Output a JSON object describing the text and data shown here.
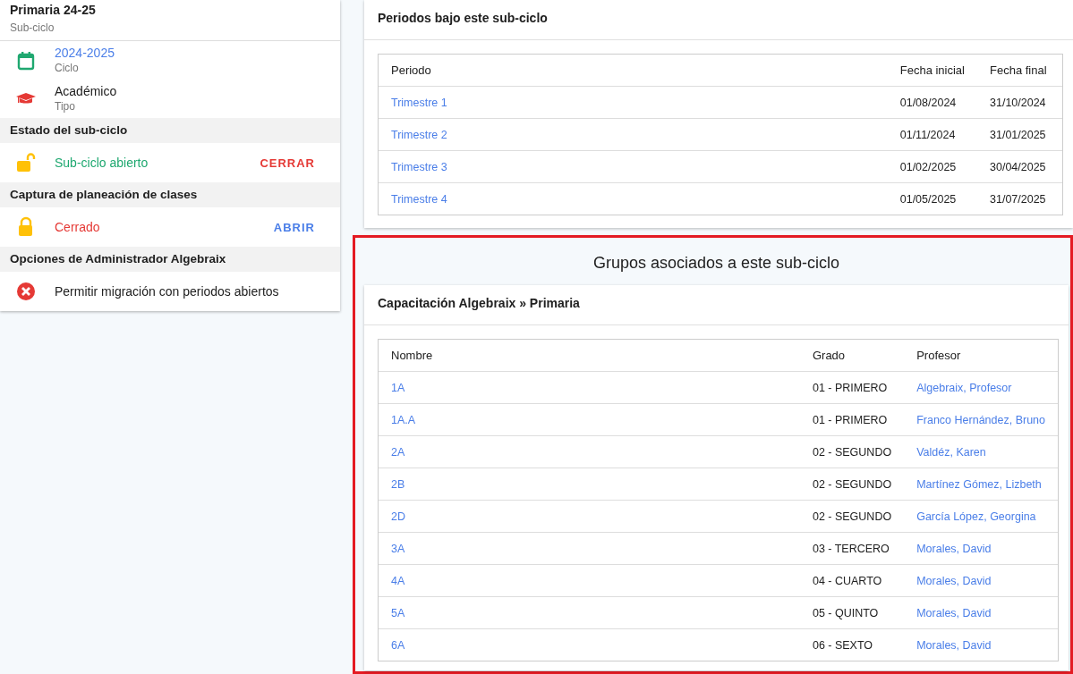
{
  "subcycle": {
    "title": "Primaria 24-25",
    "subtitle": "Sub-ciclo",
    "details": [
      {
        "kind": "calendar",
        "value": "2024-2025",
        "label": "Ciclo",
        "link": true
      },
      {
        "kind": "cap",
        "value": "Académico",
        "label": "Tipo",
        "link": false
      }
    ],
    "sections": [
      {
        "title": "Estado del sub-ciclo",
        "kind": "status",
        "open": true,
        "text": "Sub-ciclo abierto",
        "action": "CERRAR"
      },
      {
        "title": "Captura de planeación de clases",
        "kind": "status",
        "open": false,
        "text": "Cerrado",
        "action": "ABRIR"
      },
      {
        "title": "Opciones de Administrador Algebraix",
        "kind": "option",
        "enabled": false,
        "text": "Permitir migración con periodos abiertos"
      }
    ]
  },
  "periods": {
    "title": "Periodos bajo este sub-ciclo",
    "columns": [
      "Periodo",
      "Fecha inicial",
      "Fecha final"
    ],
    "rows": [
      [
        "Trimestre 1",
        "01/08/2024",
        "31/10/2024"
      ],
      [
        "Trimestre 2",
        "01/11/2024",
        "31/01/2025"
      ],
      [
        "Trimestre 3",
        "01/02/2025",
        "30/04/2025"
      ],
      [
        "Trimestre 4",
        "01/05/2025",
        "31/07/2025"
      ]
    ]
  },
  "groups": {
    "heading": "Grupos asociados a este sub-ciclo",
    "title": "Capacitación Algebraix » Primaria",
    "columns": [
      "Nombre",
      "Grado",
      "Profesor"
    ],
    "rows": [
      [
        "1A",
        "01 - PRIMERO",
        "Algebraix, Profesor"
      ],
      [
        "1A.A",
        "01 - PRIMERO",
        "Franco Hernández, Bruno"
      ],
      [
        "2A",
        "02 - SEGUNDO",
        "Valdéz, Karen"
      ],
      [
        "2B",
        "02 - SEGUNDO",
        "Martínez Gómez, Lizbeth"
      ],
      [
        "2D",
        "02 - SEGUNDO",
        "García López, Georgina"
      ],
      [
        "3A",
        "03 - TERCERO",
        "Morales, David"
      ],
      [
        "4A",
        "04 - CUARTO",
        "Morales, David"
      ],
      [
        "5A",
        "05 - QUINTO",
        "Morales, David"
      ],
      [
        "6A",
        "06 - SEXTO",
        "Morales, David"
      ]
    ]
  }
}
